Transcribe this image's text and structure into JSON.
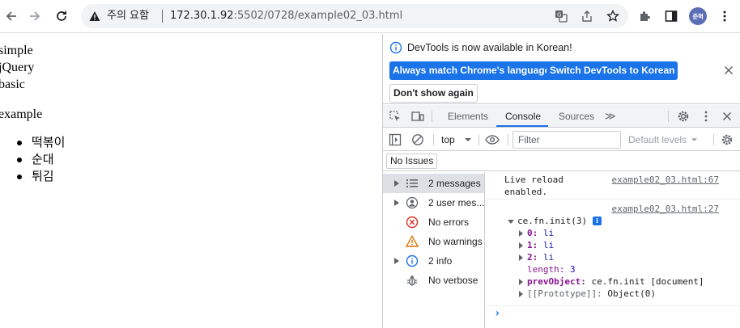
{
  "browser": {
    "omnibox": {
      "security_label": "주의 요함",
      "url_host": "172.30.1.92",
      "url_rest": ":5502/0728/example02_03.html"
    },
    "profile_initials": "준혁"
  },
  "page": {
    "lines": [
      "simple",
      "jQuery",
      "basic"
    ],
    "heading": "example",
    "list_items": [
      "떡볶이",
      "순대",
      "튀김"
    ]
  },
  "devtools": {
    "infobar": {
      "message": "DevTools is now available in Korean!",
      "btn_match": "Always match Chrome's language",
      "btn_switch": "Switch DevTools to Korean",
      "btn_dismiss": "Don't show again"
    },
    "tabs": [
      {
        "label": "Elements"
      },
      {
        "label": "Console"
      },
      {
        "label": "Sources"
      }
    ],
    "more_tabs": "≫",
    "console_toolbar": {
      "context": "top",
      "filter_placeholder": "Filter",
      "levels": "Default levels"
    },
    "issues_label": "No Issues",
    "sidebar": [
      {
        "label": "2 messages"
      },
      {
        "label": "2 user mes..."
      },
      {
        "label": "No errors"
      },
      {
        "label": "No warnings"
      },
      {
        "label": "2 info"
      },
      {
        "label": "No verbose"
      }
    ],
    "console": {
      "msg1_line1": "Live reload",
      "msg1_line2": "enabled.",
      "msg1_source": "example02_03.html:67",
      "msg2_source": "example02_03.html:27",
      "obj_title": "ce.fn.init(3)",
      "info_badge": "i",
      "rows": [
        {
          "key": "0",
          "val": "li"
        },
        {
          "key": "1",
          "val": "li"
        },
        {
          "key": "2",
          "val": "li"
        }
      ],
      "length_key": "length",
      "length_val": "3",
      "prev_key": "prevObject",
      "prev_val": "ce.fn.init [document]",
      "proto_key": "[[Prototype]]",
      "proto_val": "Object(0)",
      "prompt": "›"
    }
  },
  "colors": {
    "accent": "#1a73e8",
    "tab_underline": "#1a73e8",
    "key_purple": "#881391"
  }
}
